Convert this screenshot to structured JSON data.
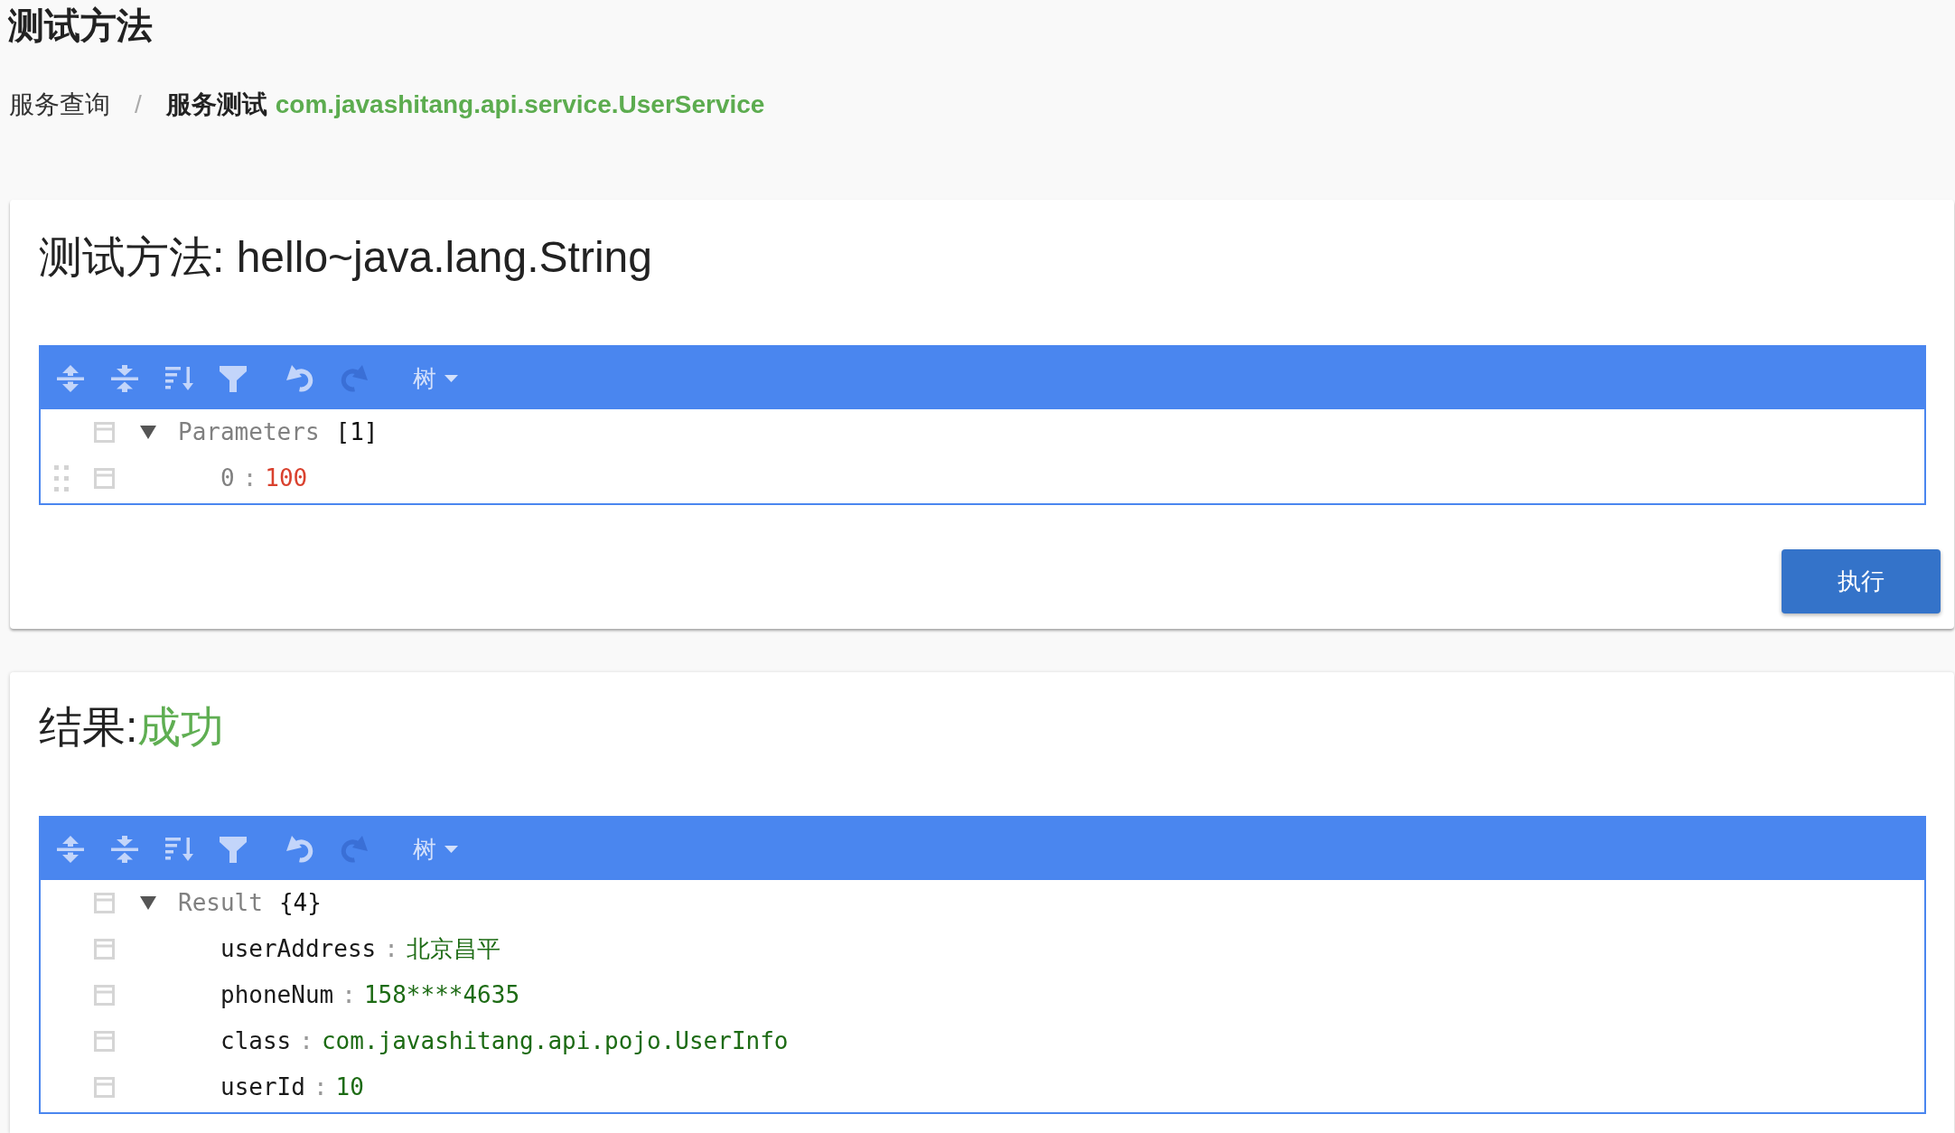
{
  "page": {
    "title": "测试方法"
  },
  "breadcrumb": {
    "items": [
      {
        "label": "服务查询",
        "selected": false
      },
      {
        "label": "服务测试",
        "selected": true
      }
    ],
    "separator": "/",
    "service": "com.javashitang.api.service.UserService"
  },
  "method_card": {
    "title": "测试方法: hello~java.lang.String",
    "editor": {
      "toolbar": {
        "buttons": [
          {
            "kind": "expand_all",
            "disabled": false
          },
          {
            "kind": "collapse_all",
            "disabled": false
          },
          {
            "kind": "sort",
            "disabled": false
          },
          {
            "kind": "filter",
            "disabled": false
          },
          {
            "kind": "undo",
            "disabled": false
          },
          {
            "kind": "redo",
            "disabled": true
          }
        ],
        "mode": "树"
      },
      "tree": [
        {
          "kind": "array",
          "key": "Parameters",
          "readonly": true,
          "count": "[1]",
          "expanded": true,
          "hovered": false,
          "children": [
            {
              "kind": "number",
              "key": "0",
              "readonly": true,
              "separator": ":",
              "value": "100",
              "hovered": true
            }
          ]
        }
      ]
    },
    "execute_button": "执行"
  },
  "result_card": {
    "title": "结果:",
    "status": {
      "text": "成功",
      "kind": "success"
    },
    "editor": {
      "toolbar": {
        "buttons": [
          {
            "kind": "expand_all",
            "disabled": false
          },
          {
            "kind": "collapse_all",
            "disabled": false
          },
          {
            "kind": "sort",
            "disabled": false
          },
          {
            "kind": "filter",
            "disabled": false
          },
          {
            "kind": "undo",
            "disabled": false
          },
          {
            "kind": "redo",
            "disabled": true
          }
        ],
        "mode": "树"
      },
      "tree": [
        {
          "kind": "object",
          "key": "Result",
          "readonly": true,
          "count": "{4}",
          "expanded": true,
          "hovered": false,
          "children": [
            {
              "kind": "string",
              "key": "userAddress",
              "readonly": false,
              "separator": ":",
              "value": "北京昌平",
              "hovered": false
            },
            {
              "kind": "string",
              "key": "phoneNum",
              "readonly": false,
              "separator": ":",
              "value": "158****4635",
              "hovered": false
            },
            {
              "kind": "string",
              "key": "class",
              "readonly": false,
              "separator": ":",
              "value": "com.javashitang.api.pojo.UserInfo",
              "hovered": false
            },
            {
              "kind": "string",
              "key": "userId",
              "readonly": false,
              "separator": ":",
              "value": "10",
              "hovered": false
            }
          ]
        }
      ]
    }
  }
}
